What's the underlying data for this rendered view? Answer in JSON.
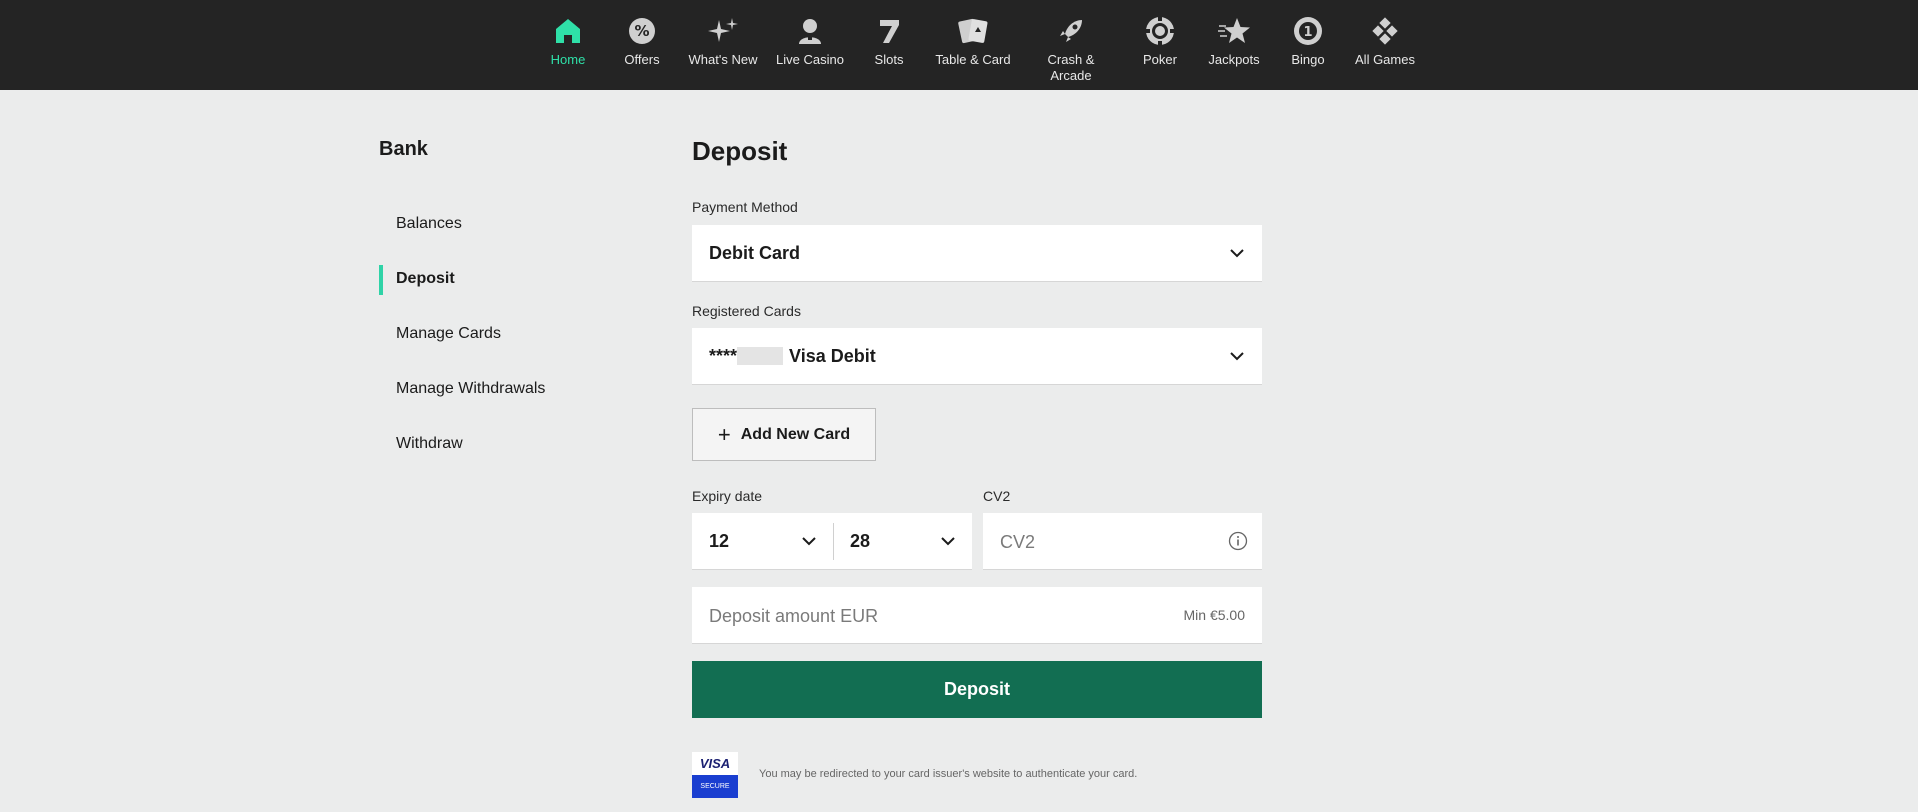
{
  "nav": {
    "items": [
      {
        "label": "Home",
        "icon": "home-icon",
        "active": true
      },
      {
        "label": "Offers",
        "icon": "percent-badge-icon"
      },
      {
        "label": "What's New",
        "icon": "sparkles-icon"
      },
      {
        "label": "Live Casino",
        "icon": "dealer-icon"
      },
      {
        "label": "Slots",
        "icon": "seven-icon"
      },
      {
        "label": "Table & Card",
        "icon": "cards-icon"
      },
      {
        "label": "Crash & Arcade",
        "icon": "rocket-icon"
      },
      {
        "label": "Poker",
        "icon": "poker-chip-icon"
      },
      {
        "label": "Jackpots",
        "icon": "star-icon"
      },
      {
        "label": "Bingo",
        "icon": "bingo-ball-icon"
      },
      {
        "label": "All Games",
        "icon": "dice-icon"
      }
    ],
    "active_color": "#2fe0a8"
  },
  "sidebar": {
    "title": "Bank",
    "items": [
      {
        "label": "Balances"
      },
      {
        "label": "Deposit",
        "active": true
      },
      {
        "label": "Manage Cards"
      },
      {
        "label": "Manage Withdrawals"
      },
      {
        "label": "Withdraw"
      }
    ]
  },
  "deposit": {
    "title": "Deposit",
    "payment_method_label": "Payment Method",
    "payment_method_value": "Debit Card",
    "registered_cards_label": "Registered Cards",
    "registered_card_prefix": "****",
    "registered_card_name": "Visa Debit",
    "add_card_label": "Add New Card",
    "expiry_label": "Expiry date",
    "expiry_month": "12",
    "expiry_year": "28",
    "cv2_label": "CV2",
    "cv2_placeholder": "CV2",
    "amount_placeholder": "Deposit amount EUR",
    "amount_min": "Min €5.00",
    "submit_label": "Deposit",
    "button_color": "#126e52"
  },
  "footer": {
    "visa_top": "VISA",
    "visa_bottom": "SECURE",
    "redirect_note": "You may be redirected to your card issuer's website to authenticate your card."
  }
}
